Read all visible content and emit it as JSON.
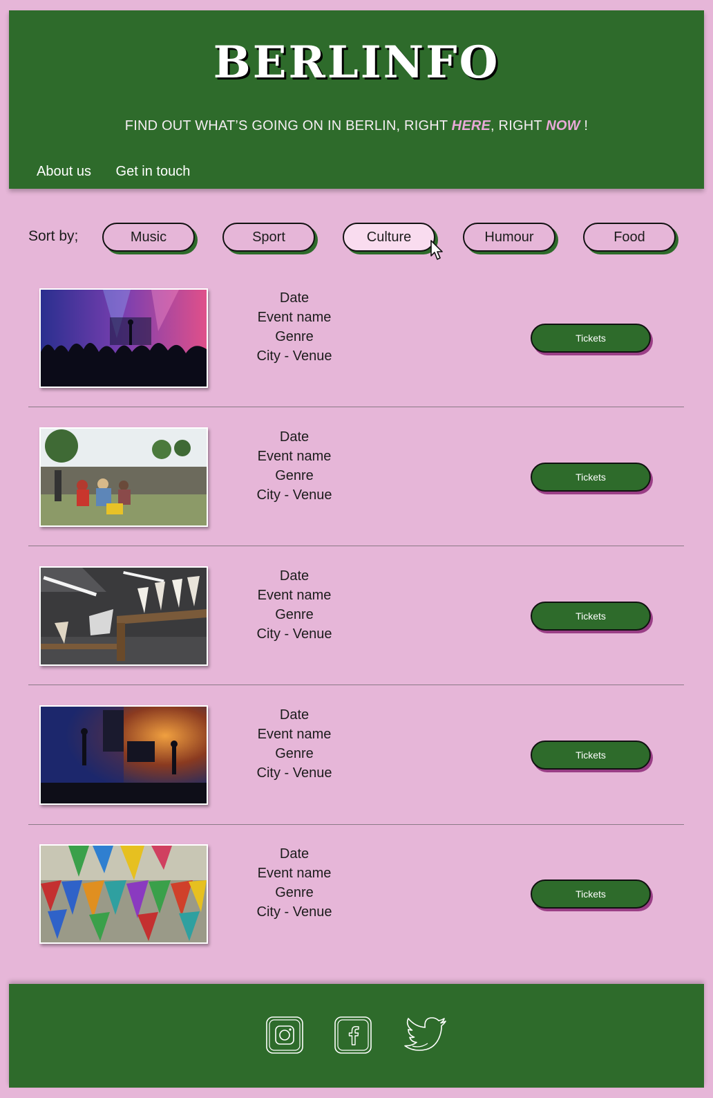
{
  "header": {
    "brand": "BERLINFO",
    "tagline": {
      "before": "FIND OUT WHAT’S GOING ON IN BERLIN, RIGHT ",
      "here": "HERE",
      "middle": ", RIGHT ",
      "now": "NOW",
      "after": " !"
    },
    "nav": [
      {
        "label": "About us"
      },
      {
        "label": "Get in touch"
      }
    ]
  },
  "sort": {
    "label": "Sort by;",
    "options": [
      {
        "label": "Music"
      },
      {
        "label": "Sport"
      },
      {
        "label": "Culture",
        "active": true
      },
      {
        "label": "Humour"
      },
      {
        "label": "Food"
      }
    ]
  },
  "events": [
    {
      "date": "Date",
      "name": "Event name",
      "genre": "Genre",
      "location": "City - Venue",
      "button": "Tickets",
      "image": "concert-crowd"
    },
    {
      "date": "Date",
      "name": "Event name",
      "genre": "Genre",
      "location": "City - Venue",
      "button": "Tickets",
      "image": "festival-lawn"
    },
    {
      "date": "Date",
      "name": "Event name",
      "genre": "Genre",
      "location": "City - Venue",
      "button": "Tickets",
      "image": "food-market"
    },
    {
      "date": "Date",
      "name": "Event name",
      "genre": "Genre",
      "location": "City - Venue",
      "button": "Tickets",
      "image": "band-stage"
    },
    {
      "date": "Date",
      "name": "Event name",
      "genre": "Genre",
      "location": "City - Venue",
      "button": "Tickets",
      "image": "bunting-flags"
    }
  ],
  "footer": {
    "social": [
      {
        "icon": "instagram-icon"
      },
      {
        "icon": "facebook-icon"
      },
      {
        "icon": "twitter-icon"
      }
    ]
  },
  "colors": {
    "background": "#e6b6d8",
    "green": "#2e6b2b",
    "accent_pink": "#e9a9d8",
    "ticket_shadow": "#9a3f86"
  }
}
